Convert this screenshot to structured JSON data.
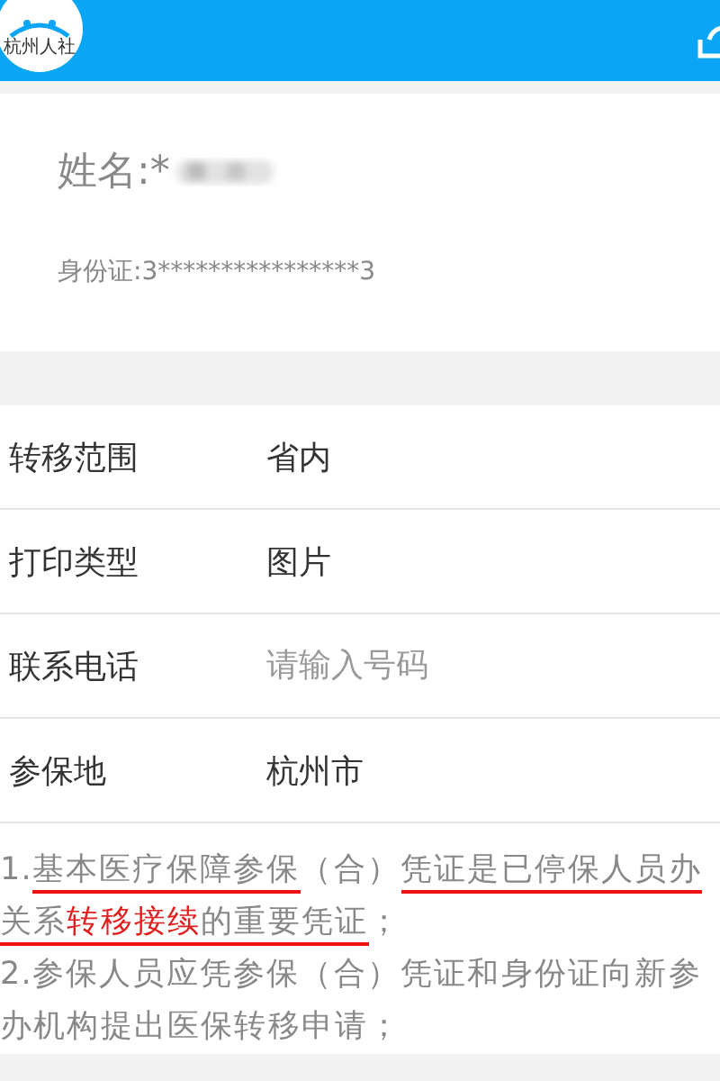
{
  "header": {
    "logo_text": "杭州人社"
  },
  "person": {
    "name_label": "姓名:*",
    "id_text": "身份证:3****************3"
  },
  "fields": [
    {
      "kind": "value",
      "label": "转移范围",
      "value": "省内"
    },
    {
      "kind": "value",
      "label": "打印类型",
      "value": "图片"
    },
    {
      "kind": "input",
      "label": "联系电话",
      "placeholder": "请输入号码"
    },
    {
      "kind": "value",
      "label": "参保地",
      "value": "杭州市"
    }
  ],
  "notes": [
    [
      {
        "text": "1.",
        "underlined": false,
        "highlighted": false
      },
      {
        "text": "基本医疗保障参保",
        "underlined": true,
        "highlighted": false
      },
      {
        "text": "（合）",
        "underlined": false,
        "highlighted": false
      },
      {
        "text": "凭证是已停保人员办",
        "underlined": true,
        "highlighted": false
      }
    ],
    [
      {
        "text": "关系",
        "underlined": true,
        "highlighted": false
      },
      {
        "text": "转移接续",
        "underlined": true,
        "highlighted": true
      },
      {
        "text": "的重要凭证",
        "underlined": true,
        "highlighted": false
      },
      {
        "text": "；",
        "underlined": false,
        "highlighted": false
      }
    ],
    [
      {
        "text": "2.参保人员应凭参保（合）凭证和身份证向新参",
        "underlined": false,
        "highlighted": false
      }
    ],
    [
      {
        "text": "办机构提出医保转移申请；",
        "underlined": false,
        "highlighted": false
      }
    ]
  ]
}
